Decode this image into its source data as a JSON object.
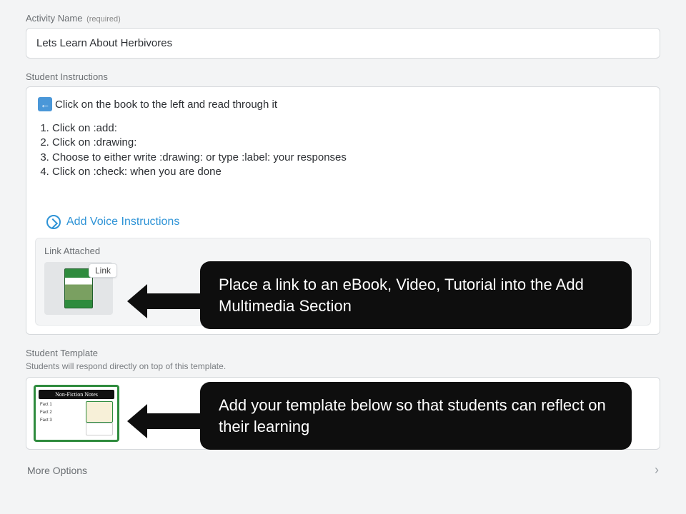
{
  "activity_name": {
    "label": "Activity Name",
    "required_tag": "(required)",
    "value": "Lets Learn About Herbivores"
  },
  "student_instructions": {
    "label": "Student Instructions",
    "top_line": "Click on the book to the left and read through it",
    "steps": [
      "Click on :add:",
      "Click on :drawing:",
      "Choose to either write :drawing: or type :label: your responses",
      "Click on :check: when you are done"
    ],
    "voice_label": "Add Voice Instructions"
  },
  "link_attached": {
    "label": "Link Attached",
    "badge": "Link"
  },
  "student_template": {
    "label": "Student Template",
    "description_visible": "Students will respond directly on top of this template.",
    "thumb_title": "Non-Fiction Notes",
    "thumb_rows": [
      "Fact 1",
      "Fact 2",
      "Fact 3"
    ]
  },
  "more_options": {
    "label": "More Options"
  },
  "callouts": {
    "c1": "Place a link to an eBook, Video, Tutorial into the Add Multimedia Section",
    "c2": "Add your template below so that students can reflect on their learning"
  }
}
